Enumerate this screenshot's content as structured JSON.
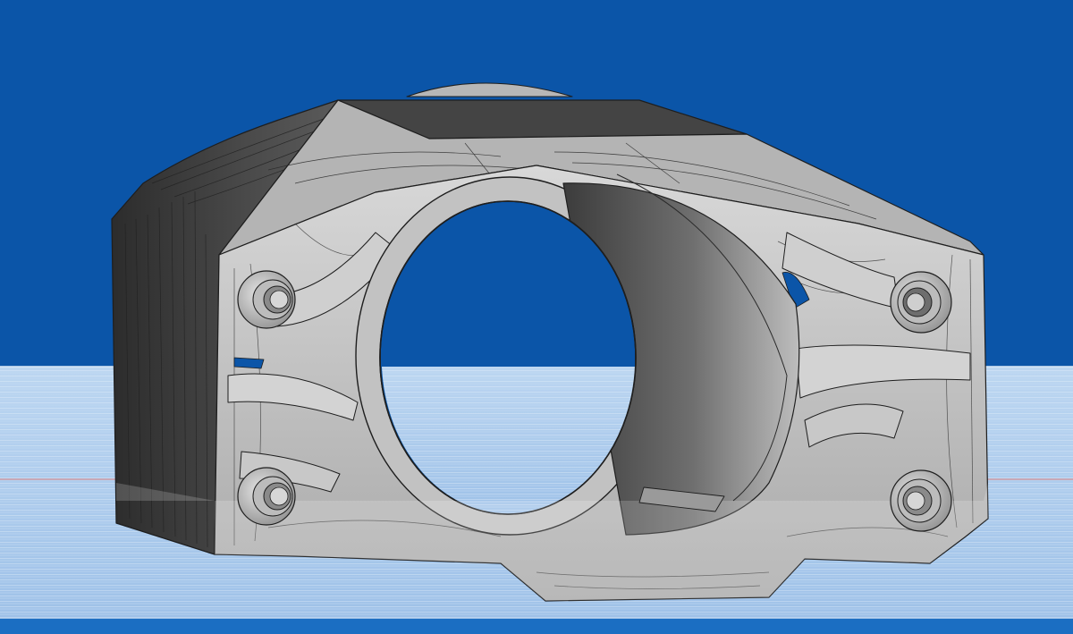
{
  "viewport": {
    "model": "topology-optimized-bracket",
    "view": "front-isometric",
    "status_text": ""
  },
  "colors": {
    "background": "#0b55a8",
    "floor_grid": "#a9c9ec",
    "floor_line": "#dbe9f8",
    "floor_axis": "#d9807e",
    "bottom_bar": "#1b6ec2",
    "model_dark": "#3f3f3f",
    "model_mid": "#8d8d8d",
    "model_light": "#d7d7d7",
    "model_edge": "#1e1e1e"
  },
  "icons": {
    "bolt_holes": "bolt-boss-icon",
    "bore": "central-bore"
  }
}
